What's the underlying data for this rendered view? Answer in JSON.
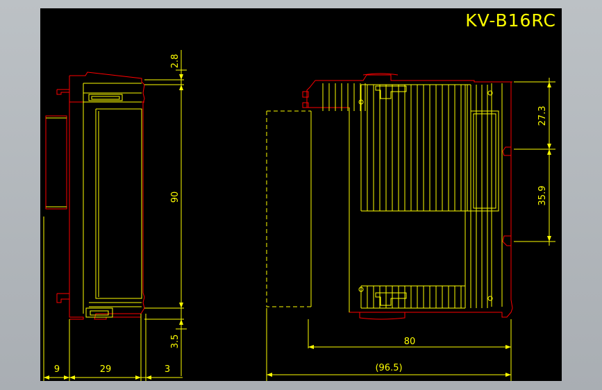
{
  "drawing": {
    "title": "KV-B16RC",
    "dimensions": {
      "top_gap": "2.8",
      "height_main": "90",
      "bottom_gap": "3.5",
      "left_offset": "9",
      "body_depth": "29",
      "right_offset": "3",
      "upper_rail": "27.3",
      "lower_rail": "35.9",
      "body_length": "80",
      "overall_length": "(96.5)"
    }
  },
  "colors": {
    "background_outer": "#b4b9bd",
    "sheet": "#000000",
    "outline": "#ff0000",
    "detail": "#ffff00"
  }
}
